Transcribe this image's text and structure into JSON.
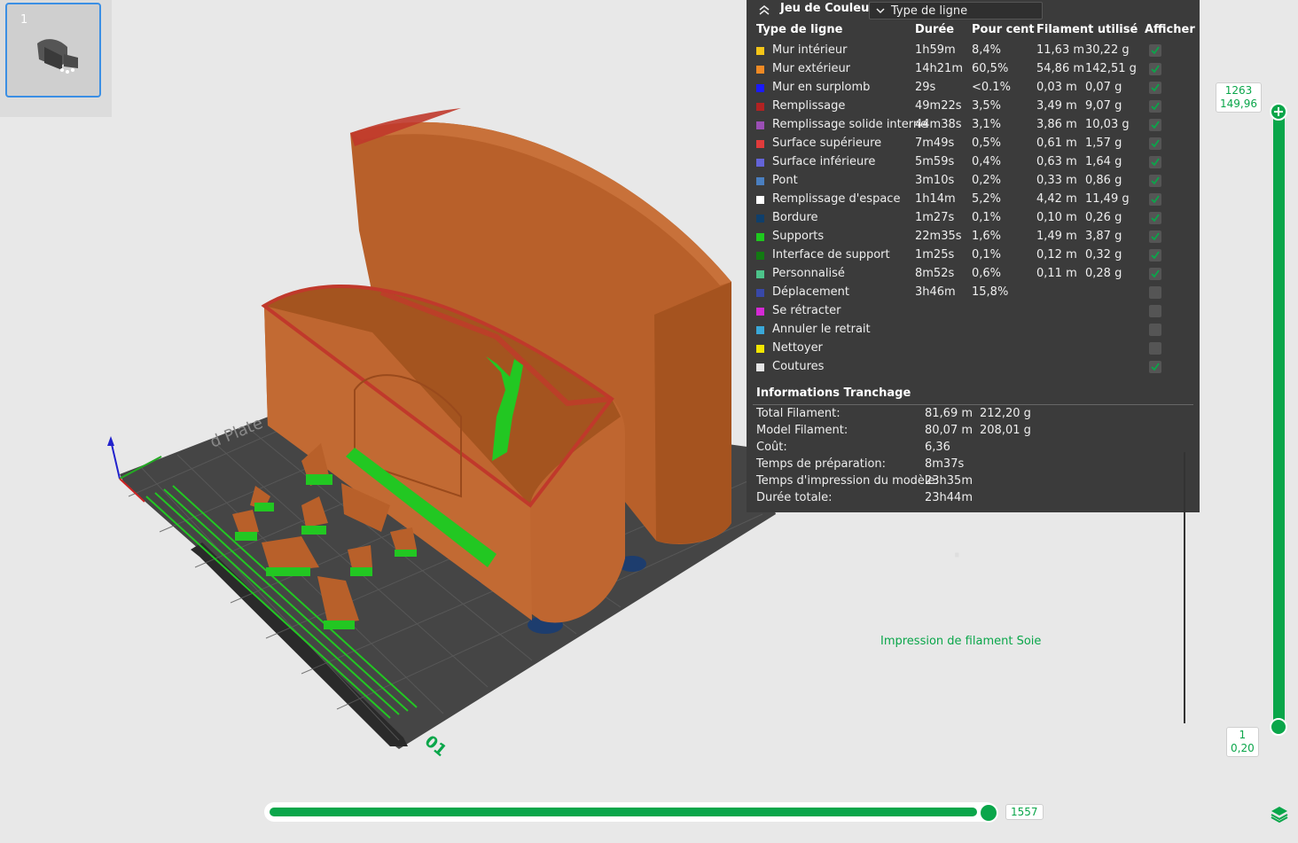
{
  "plate": {
    "number": "1"
  },
  "legend": {
    "title": "Jeu de Couleur",
    "view_mode": "Type de ligne",
    "columns": [
      "Type de ligne",
      "Durée",
      "Pour cent",
      "Filament utilisé",
      "Afficher"
    ],
    "rows": [
      {
        "name": "Mur intérieur",
        "color": "#f5c518",
        "duration": "1h59m",
        "percent": "8,4%",
        "length": "11,63 m",
        "weight": "30,22 g",
        "shown": true
      },
      {
        "name": "Mur extérieur",
        "color": "#f08a24",
        "duration": "14h21m",
        "percent": "60,5%",
        "length": "54,86 m",
        "weight": "142,51 g",
        "shown": true
      },
      {
        "name": "Mur en surplomb",
        "color": "#1a1aff",
        "duration": "29s",
        "percent": "<0.1%",
        "length": "0,03 m",
        "weight": "0,07 g",
        "shown": true
      },
      {
        "name": "Remplissage",
        "color": "#b22222",
        "duration": "49m22s",
        "percent": "3,5%",
        "length": "3,49 m",
        "weight": "9,07 g",
        "shown": true
      },
      {
        "name": "Remplissage solide interne",
        "color": "#9b4fb5",
        "duration": "44m38s",
        "percent": "3,1%",
        "length": "3,86 m",
        "weight": "10,03 g",
        "shown": true
      },
      {
        "name": "Surface supérieure",
        "color": "#e03b3b",
        "duration": "7m49s",
        "percent": "0,5%",
        "length": "0,61 m",
        "weight": "1,57 g",
        "shown": true
      },
      {
        "name": "Surface inférieure",
        "color": "#6464d8",
        "duration": "5m59s",
        "percent": "0,4%",
        "length": "0,63 m",
        "weight": "1,64 g",
        "shown": true
      },
      {
        "name": "Pont",
        "color": "#4a7fc0",
        "duration": "3m10s",
        "percent": "0,2%",
        "length": "0,33 m",
        "weight": "0,86 g",
        "shown": true
      },
      {
        "name": "Remplissage d'espace",
        "color": "#ffffff",
        "duration": "1h14m",
        "percent": "5,2%",
        "length": "4,42 m",
        "weight": "11,49 g",
        "shown": true
      },
      {
        "name": "Bordure",
        "color": "#0f3f6b",
        "duration": "1m27s",
        "percent": "0,1%",
        "length": "0,10 m",
        "weight": "0,26 g",
        "shown": true
      },
      {
        "name": "Supports",
        "color": "#1ec81e",
        "duration": "22m35s",
        "percent": "1,6%",
        "length": "1,49 m",
        "weight": "3,87 g",
        "shown": true
      },
      {
        "name": "Interface de support",
        "color": "#127a12",
        "duration": "1m25s",
        "percent": "0,1%",
        "length": "0,12 m",
        "weight": "0,32 g",
        "shown": true
      },
      {
        "name": "Personnalisé",
        "color": "#4cc38a",
        "duration": "8m52s",
        "percent": "0,6%",
        "length": "0,11 m",
        "weight": "0,28 g",
        "shown": true
      },
      {
        "name": "Déplacement",
        "color": "#3848a8",
        "duration": "3h46m",
        "percent": "15,8%",
        "length": "",
        "weight": "",
        "shown": false
      },
      {
        "name": "Se rétracter",
        "color": "#d42ad4",
        "duration": "",
        "percent": "",
        "length": "",
        "weight": "",
        "shown": false
      },
      {
        "name": "Annuler le retrait",
        "color": "#3aa8d8",
        "duration": "",
        "percent": "",
        "length": "",
        "weight": "",
        "shown": false
      },
      {
        "name": "Nettoyer",
        "color": "#f2e600",
        "duration": "",
        "percent": "",
        "length": "",
        "weight": "",
        "shown": false
      },
      {
        "name": "Coutures",
        "color": "#e6e6e6",
        "duration": "",
        "percent": "",
        "length": "",
        "weight": "",
        "shown": true
      }
    ],
    "info_title": "Informations Tranchage",
    "info": [
      {
        "label": "Total Filament:",
        "v1": "81,69 m",
        "v2": "212,20 g"
      },
      {
        "label": "Model Filament:",
        "v1": "80,07 m",
        "v2": "208,01 g"
      },
      {
        "label": "Coût:",
        "v1": "6,36",
        "v2": ""
      },
      {
        "label": "Temps de préparation:",
        "v1": "8m37s",
        "v2": ""
      },
      {
        "label": "Temps d'impression du modèle:",
        "v1": "23h35m",
        "v2": ""
      },
      {
        "label": "Durée totale:",
        "v1": "23h44m",
        "v2": ""
      }
    ]
  },
  "vslider": {
    "top_layer": "1263",
    "top_height": "149,96",
    "bottom_layer": "1",
    "bottom_height": "0,20",
    "accent": "#0aa64a"
  },
  "hslider": {
    "value": "1557",
    "fraction": 0.98
  },
  "viewport": {
    "filament_note": "Impression de filament Soie",
    "plate_label_near": "01"
  }
}
